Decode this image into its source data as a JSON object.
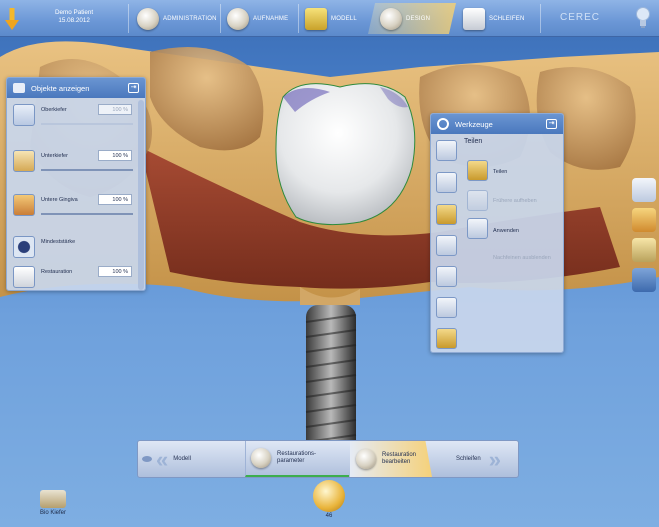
{
  "topbar": {
    "patient_name": "Demo Patient",
    "patient_date": "15.08.2012",
    "tabs": [
      {
        "label": "ADMINISTRATION",
        "icon": "teeth-jaw-icon"
      },
      {
        "label": "AUFNAHME",
        "icon": "scan-jaw-icon"
      },
      {
        "label": "MODELL",
        "icon": "model-block-icon"
      },
      {
        "label": "DESIGN",
        "icon": "crown-design-icon"
      },
      {
        "label": "SCHLEIFEN",
        "icon": "milling-unit-icon"
      }
    ],
    "brand": "CEREC",
    "accent": "#f5c74a"
  },
  "objects_panel": {
    "title": "Objekte anzeigen",
    "items": [
      {
        "label": "Oberkiefer",
        "value": "100 %",
        "enabled": false,
        "level": 1.0
      },
      {
        "label": "Unterkiefer",
        "value": "100 %",
        "enabled": true,
        "level": 1.0
      },
      {
        "label": "Untere Gingiva",
        "value": "100 %",
        "enabled": true,
        "level": 1.0
      },
      {
        "label": "Mindeststärke",
        "value": "",
        "enabled": true
      },
      {
        "label": "Restauration",
        "value": "100 %",
        "enabled": true,
        "level": 1.0
      }
    ]
  },
  "tools_panel": {
    "title": "Werkzeuge",
    "section": "Teilen",
    "sub_items": [
      {
        "label": "Teilen",
        "enabled": true
      },
      {
        "label": "Frühere aufheben",
        "enabled": false
      },
      {
        "label": "Anwenden",
        "enabled": true
      },
      {
        "label": "Nachfeinen ausblenden",
        "enabled": false
      }
    ]
  },
  "bottom_nav": {
    "prev": "Modell",
    "steps": [
      {
        "label": "Restaurations-\nparameter"
      },
      {
        "label": "Restauration\nbearbeiten"
      }
    ],
    "next": "Schleifen"
  },
  "footer": {
    "bio_label": "Bio Kiefer",
    "tooth_number": "46"
  }
}
